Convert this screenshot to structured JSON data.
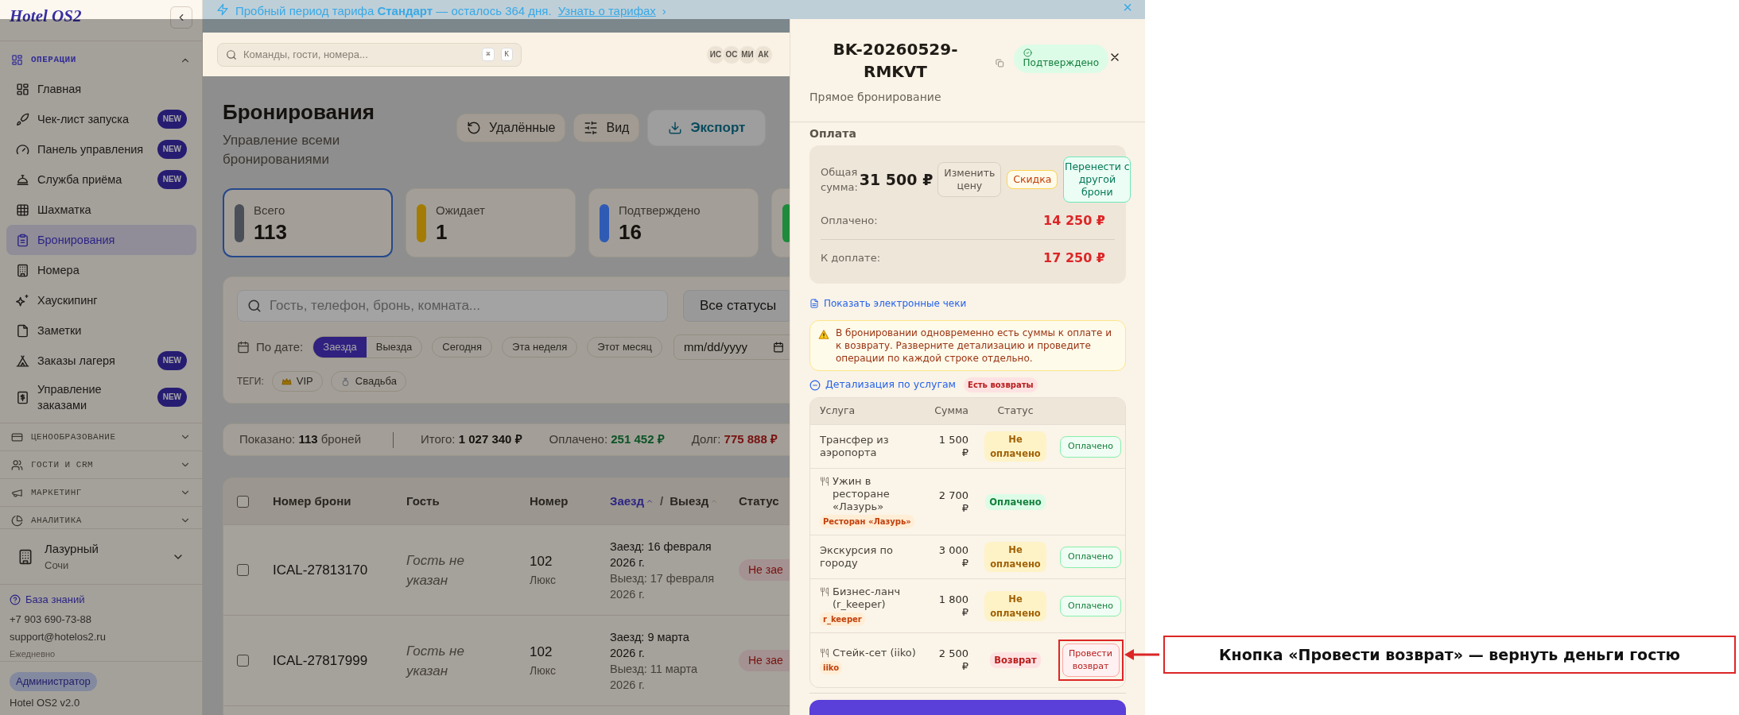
{
  "banner": {
    "text": "Пробный период тарифа **Стандарт** — осталось 364 дня.",
    "link": "Узнать о тарифах",
    "link_arrow": "›",
    "close": "×"
  },
  "sidebar": {
    "logo": "Hotel OS2",
    "sections": [
      {
        "label": "ОПЕРАЦИИ",
        "expanded": true,
        "items": [
          {
            "label": "Главная",
            "selected": false
          },
          {
            "label": "Чек-лист запуска",
            "badge": "NEW",
            "selected": false
          },
          {
            "label": "Панель управления",
            "badge": "NEW",
            "selected": false
          },
          {
            "label": "Служба приёма",
            "badge": "NEW",
            "selected": false
          },
          {
            "label": "Шахматка",
            "selected": false
          },
          {
            "label": "Бронирования",
            "selected": true
          },
          {
            "label": "Номера",
            "selected": false
          },
          {
            "label": "Хаускипинг",
            "selected": false
          },
          {
            "label": "Заметки",
            "selected": false
          },
          {
            "label": "Заказы лагеря",
            "badge": "NEW",
            "selected": false
          },
          {
            "label": "Управление заказами",
            "badge": "NEW",
            "selected": false
          }
        ]
      },
      {
        "label": "ЦЕНООБРАЗОВАНИЕ",
        "expanded": false
      },
      {
        "label": "ГОСТИ И CRM",
        "expanded": false
      },
      {
        "label": "МАРКЕТИНГ",
        "expanded": false
      },
      {
        "label": "АНАЛИТИКА",
        "expanded": false
      }
    ],
    "property": {
      "name": "Лазурный",
      "city": "Сочи"
    },
    "help": {
      "link": "База знаний",
      "phone": "+7 903 690-73-88",
      "email": "support@hotelos2.ru",
      "hours": "Ежедневно"
    },
    "role": "Администратор",
    "version": "Hotel OS2 v2.0"
  },
  "topbar": {
    "search": {
      "placeholder": "Команды, гости, номера..."
    },
    "shortcut": [
      "⌘",
      "K"
    ],
    "avatars": [
      "ИС",
      "ОС",
      "МИ",
      "АК"
    ]
  },
  "page": {
    "title": "Бронирования",
    "subtitle": "Управление всеми бронированиями",
    "actions": [
      {
        "label": "Удалённые",
        "kind": "restore"
      },
      {
        "label": "Вид",
        "kind": "view"
      },
      {
        "label": "Экспорт",
        "kind": "export"
      }
    ],
    "stats": [
      {
        "label": "Всего",
        "value": "113",
        "color": "#4b4f57",
        "selected": true
      },
      {
        "label": "Ожидает",
        "value": "1",
        "color": "#a47c05",
        "selected": false
      },
      {
        "label": "Подтверждено",
        "value": "16",
        "color": "#2f5bb5",
        "selected": false
      },
      {
        "color": "#1e8a3c",
        "selected": false
      }
    ],
    "filters": {
      "search": {
        "placeholder": "Гость, телефон, бронь, комната..."
      },
      "status": "Все статусы",
      "date_label": "По дате:",
      "date_modes": [
        {
          "label": "Заезда",
          "selected": true
        },
        {
          "label": "Выезда",
          "selected": false
        }
      ],
      "presets": [
        "Сегодня",
        "Эта неделя",
        "Этот месяц"
      ],
      "date": {
        "placeholder": "mm/dd/yyyy"
      },
      "tags_label": "ТЕГИ:",
      "tags": [
        {
          "label": "VIP",
          "kind": "vip"
        },
        {
          "label": "Свадьба",
          "kind": "wedding"
        }
      ]
    },
    "summary": [
      {
        "label": "Показано:",
        "value": "113",
        "unit": "броней",
        "kind": "count"
      },
      {
        "label": "Итого:",
        "value": "1 027 340 ₽",
        "kind": "total"
      },
      {
        "label": "Оплачено:",
        "value": "251 452 ₽",
        "kind": "paid"
      },
      {
        "label": "Долг:",
        "value": "775 888 ₽",
        "kind": "debt"
      }
    ],
    "table": {
      "select_all": {
        "checked": false
      },
      "columns": [
        {
          "kind": "plain",
          "label": "Номер брони"
        },
        {
          "kind": "plain",
          "label": "Гость"
        },
        {
          "kind": "plain",
          "label": "Номер"
        },
        {
          "kind": "dates",
          "separator": "/",
          "items": [
            {
              "label": "Заезд",
              "selected": true
            },
            {
              "label": "Выезд",
              "selected": false
            }
          ]
        },
        {
          "kind": "plain",
          "label": "Статус"
        }
      ],
      "rows": [
        {
          "checked": false,
          "id": "ICAL-27813170",
          "guest": "Гость не указан",
          "room": "102",
          "room_type": "Люкс",
          "checkin": "Заезд: 16 февраля 2026 г.",
          "checkout": "Выезд: 17 февраля 2026 г.",
          "status": "Не зае"
        },
        {
          "checked": false,
          "id": "ICAL-27817999",
          "guest": "Гость не указан",
          "room": "102",
          "room_type": "Люкс",
          "checkin": "Заезд: 9 марта 2026 г.",
          "checkout": "Выезд: 11 марта 2026 г.",
          "status": "Не зае"
        }
      ]
    }
  },
  "drawer": {
    "number": "BK-20260529-RMKVT",
    "status": "Подтверждено",
    "source": "Прямое бронирование",
    "payment": {
      "heading": "Оплата",
      "total_label": "Общая сумма:",
      "total": "31 500 ₽",
      "actions": [
        {
          "label": "Изменить цену",
          "kind": "neutral"
        },
        {
          "label": "Скидка",
          "kind": "discount"
        },
        {
          "label": "Перенести с другой брони",
          "kind": "transfer"
        }
      ],
      "lines": [
        {
          "label": "Оплачено:",
          "value": "14 250 ₽"
        },
        {
          "label": "К доплате:",
          "value": "17 250 ₽"
        }
      ]
    },
    "receipts_link": "Показать электронные чеки",
    "warning": "В бронировании одновременно есть суммы к оплате и к возврату. Разверните детализацию и проведите операции по каждой строке отдельно.",
    "breakdown": {
      "label": "Детализация по услугам",
      "expanded": true,
      "badge": "Есть возвраты",
      "columns": [
        "Услуга",
        "Сумма",
        "Статус"
      ],
      "rows": [
        {
          "kind": "service",
          "name": "Трансфер из аэропорта",
          "amount": "1 500 ₽",
          "status": {
            "label": "Не оплачено",
            "kind": "unpaid"
          },
          "action": {
            "label": "Оплачено",
            "kind": "mark_paid"
          },
          "highlighted": false
        },
        {
          "kind": "restaurant",
          "name": "Ужин в ресторане «Лазурь»",
          "tag": "Ресторан «Лазурь»",
          "amount": "2 700 ₽",
          "status": {
            "label": "Оплачено",
            "kind": "paid"
          },
          "highlighted": false
        },
        {
          "kind": "service",
          "name": "Экскурсия по городу",
          "amount": "3 000 ₽",
          "status": {
            "label": "Не оплачено",
            "kind": "unpaid"
          },
          "action": {
            "label": "Оплачено",
            "kind": "mark_paid"
          },
          "highlighted": false
        },
        {
          "kind": "restaurant",
          "name": "Бизнес-ланч (r_keeper)",
          "tag": "r_keeper",
          "amount": "1 800 ₽",
          "status": {
            "label": "Не оплачено",
            "kind": "unpaid"
          },
          "action": {
            "label": "Оплачено",
            "kind": "mark_paid"
          },
          "highlighted": false
        },
        {
          "kind": "restaurant",
          "name": "Стейк-сет (iiko)",
          "tag": "iiko",
          "amount": "2 500 ₽",
          "status": {
            "label": "Возврат",
            "kind": "refund"
          },
          "action": {
            "label": "Провести возврат",
            "kind": "refund"
          },
          "highlighted": true
        }
      ]
    }
  },
  "annotation": {
    "text": "Кнопка «Провести возврат» — вернуть деньги гостю"
  }
}
